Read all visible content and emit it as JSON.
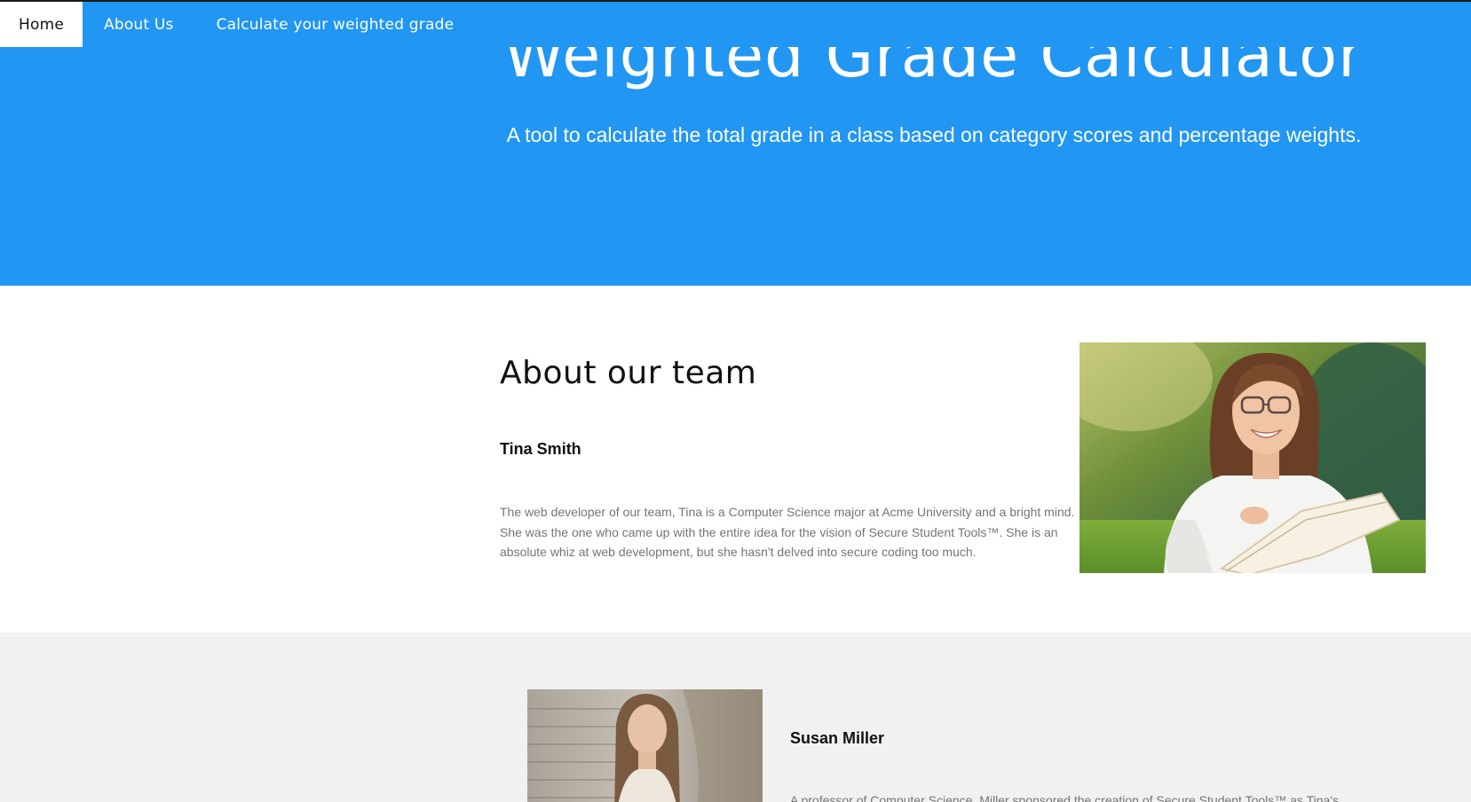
{
  "nav": {
    "items": [
      {
        "label": "Home",
        "active": true
      },
      {
        "label": "About Us",
        "active": false
      },
      {
        "label": "Calculate your weighted grade",
        "active": false
      }
    ]
  },
  "hero": {
    "title": "Weighted Grade Calculator",
    "subtitle": "A tool to calculate the total grade in a class based on category scores and percentage weights."
  },
  "team": {
    "heading": "About our team",
    "members": [
      {
        "name": "Tina Smith",
        "bio": "The web developer of our team, Tina is a Computer Science major at Acme University and a bright mind. She was the one who came up with the entire idea for the vision of Secure Student Tools™. She is an absolute whiz at web development, but she hasn't delved into secure coding too much."
      },
      {
        "name": "Susan Miller",
        "bio": "A professor of Computer Science, Miller sponsored the creation of Secure Student Tools™ as Tina's"
      }
    ]
  },
  "colors": {
    "brand": "#2196f3",
    "section_alt_bg": "#f1f1f1",
    "bio_text": "#757575"
  }
}
